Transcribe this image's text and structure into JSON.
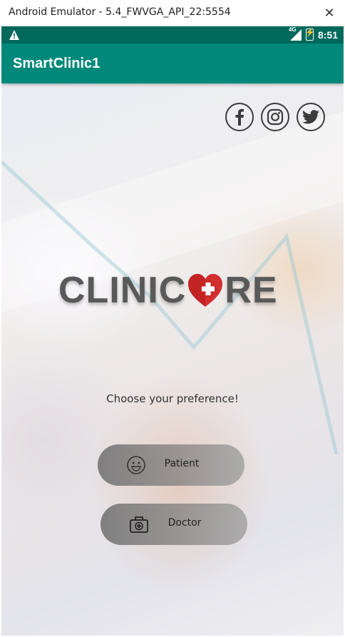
{
  "window": {
    "title": "Android Emulator - 5.4_FWVGA_API_22:5554"
  },
  "statusbar": {
    "network": "4G",
    "time": "8:51"
  },
  "appbar": {
    "title": "SmartClinic1"
  },
  "social": [
    "facebook-icon",
    "instagram-icon",
    "twitter-icon"
  ],
  "logo": {
    "text_left": "CLINIC",
    "text_right": "RE",
    "icon": "heart-cross-icon"
  },
  "prompt": "Choose your preference!",
  "buttons": {
    "patient": {
      "label": "Patient",
      "icon": "smiley-face-icon"
    },
    "doctor": {
      "label": "Doctor",
      "icon": "medical-kit-icon"
    }
  },
  "colors": {
    "statusbar": "#00695c",
    "appbar": "#00897b",
    "heart": "#d32f2f",
    "logo_text": "#595959"
  }
}
